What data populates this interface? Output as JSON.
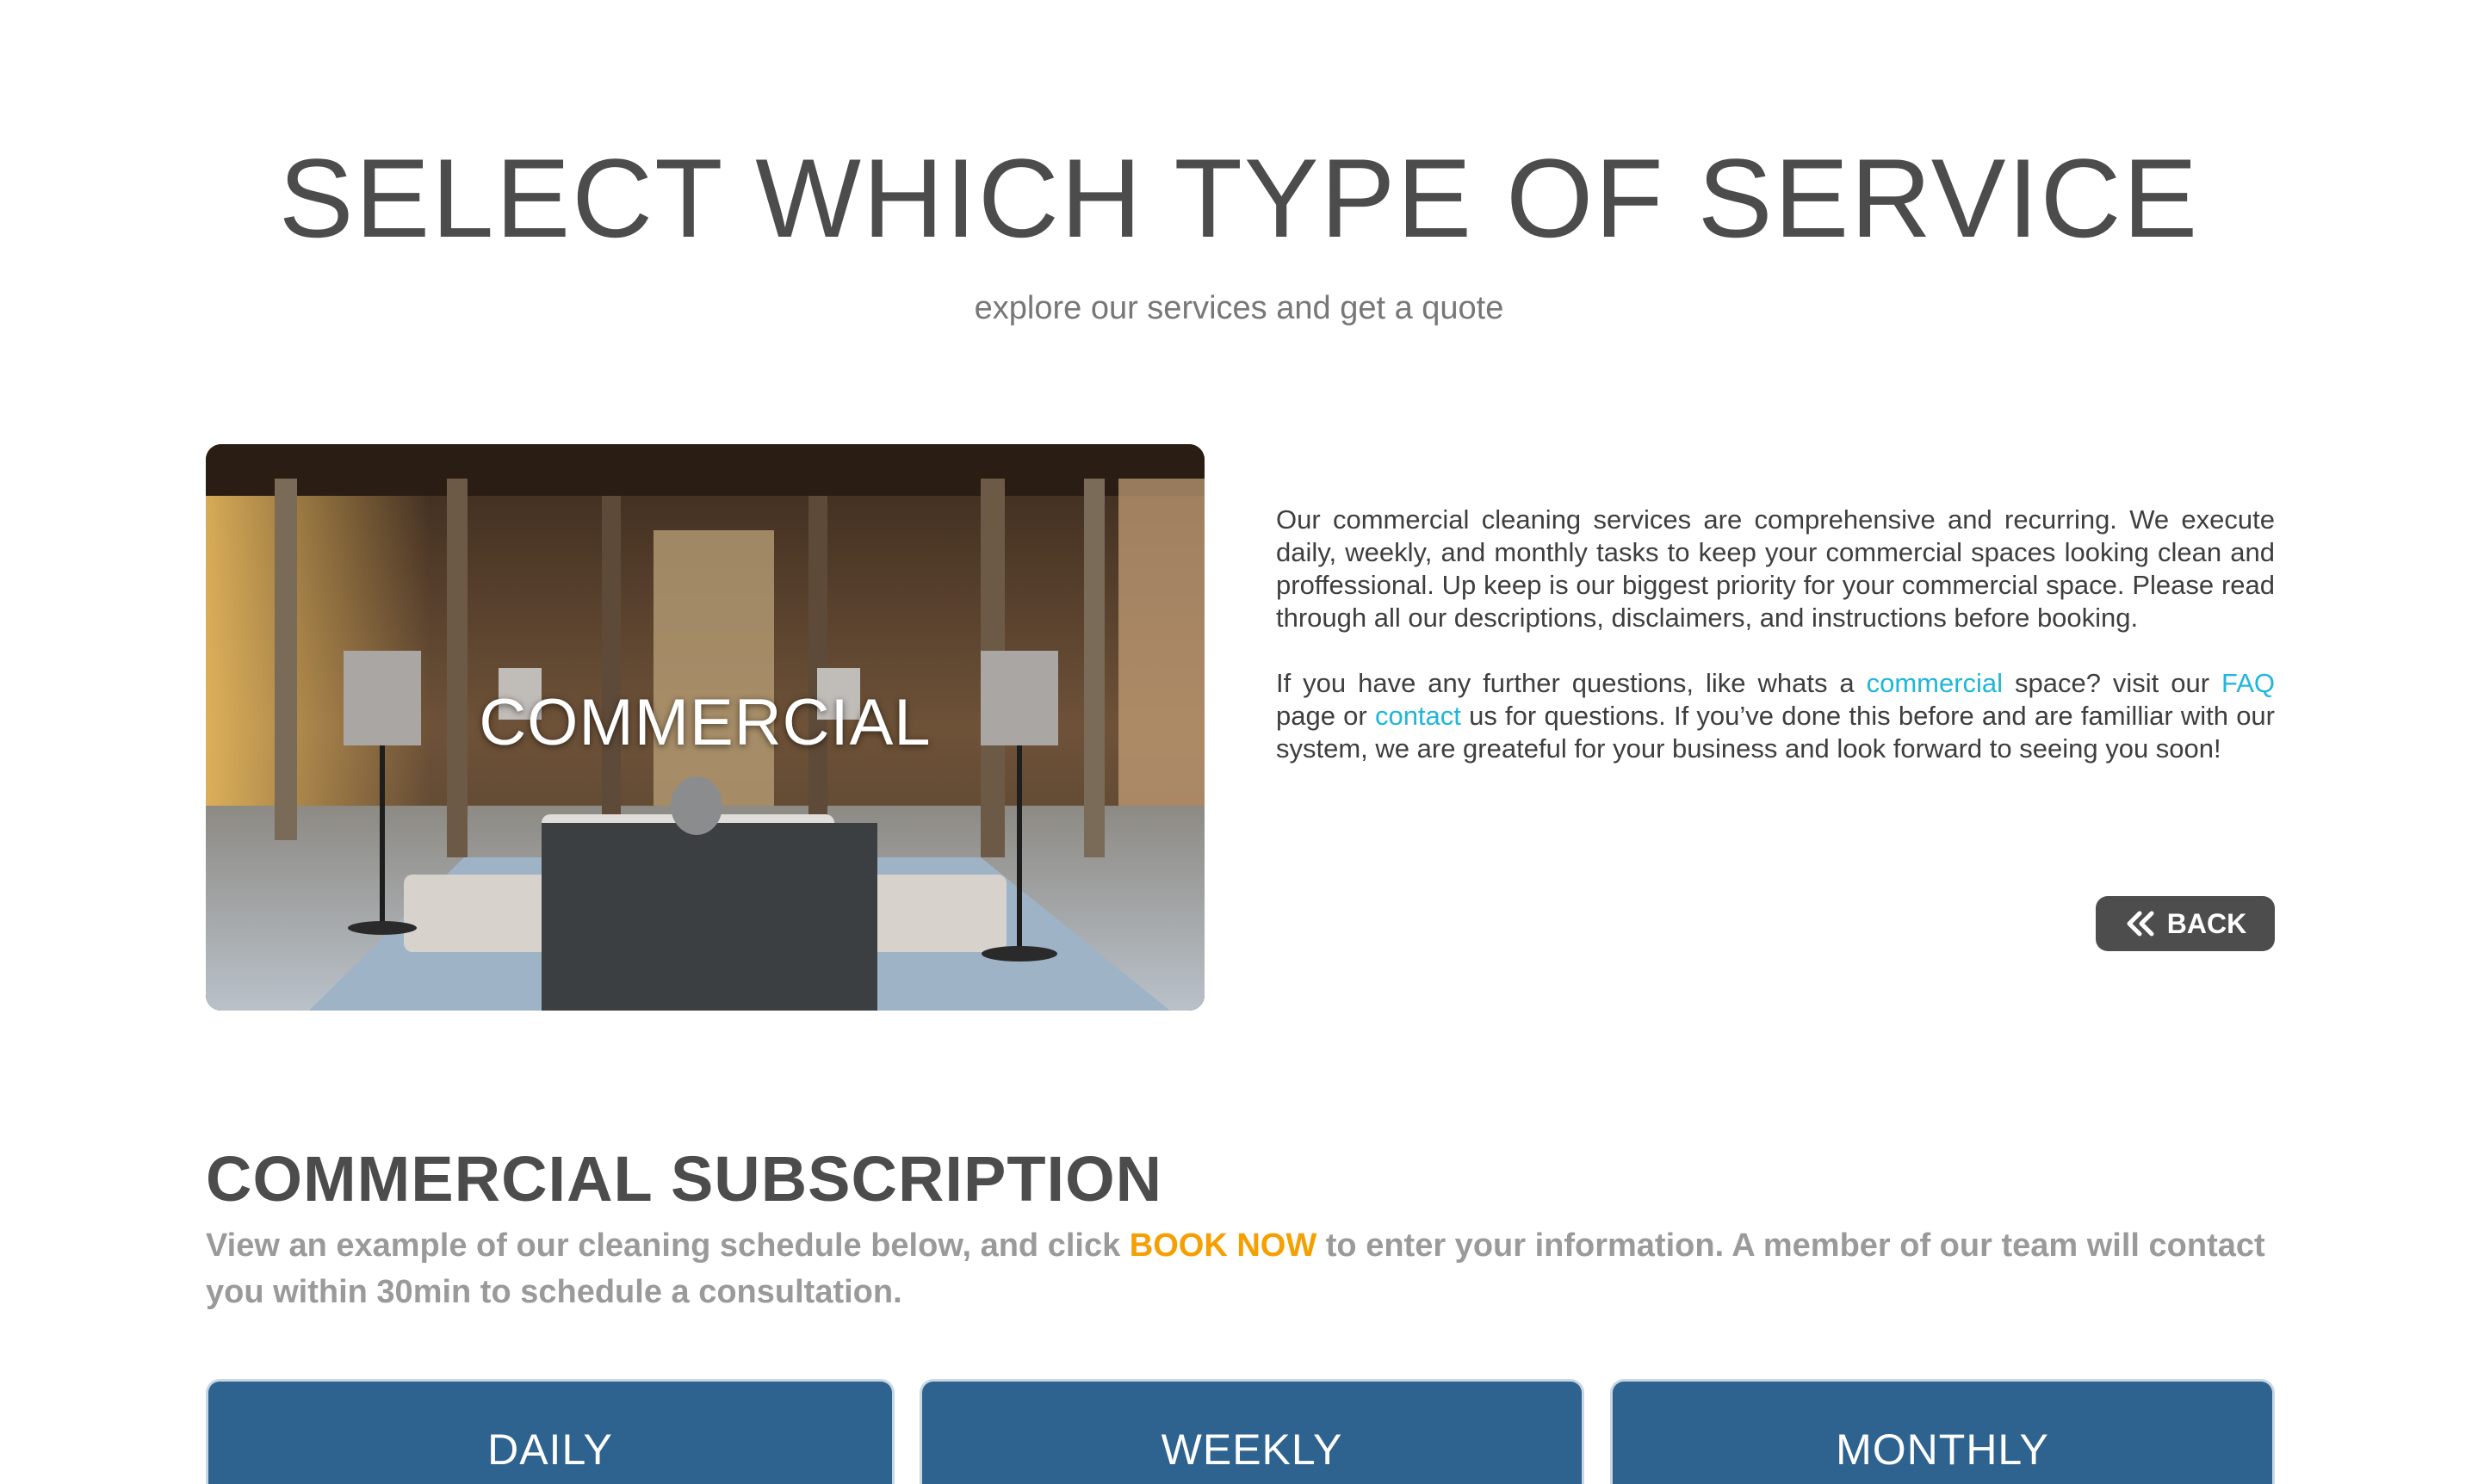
{
  "header": {
    "title": "SELECT WHICH TYPE OF SERVICE",
    "subtitle": "explore our services and get a quote"
  },
  "hero": {
    "label": "COMMERCIAL",
    "image_desc": "commercial-lobby-photo"
  },
  "description": {
    "p1": "Our commercial cleaning services are comprehensive and recurring. We execute daily, weekly, and monthly tasks to keep your commercial spaces looking clean and proffessional. Up keep is our biggest priority for your commercial space. Please read through all our descriptions, disclaimers, and instructions before booking.",
    "p2_a": "If you have any further questions, like whats a ",
    "p2_link1": "commercial",
    "p2_b": " space? visit our ",
    "p2_link2": "FAQ",
    "p2_c": " page or ",
    "p2_link3": "contact",
    "p2_d": " us for questions. If you’ve done this before and are familliar with our system, we are greateful for your business and look forward to seeing you soon!"
  },
  "back_button": {
    "label": "BACK",
    "icon": "double-chevron-left-icon"
  },
  "subscription": {
    "title": "COMMERCIAL SUBSCRIPTION",
    "text_a": "View an example of our cleaning schedule below, and click ",
    "book_now": "BOOK NOW",
    "text_b": " to enter your information. A member of our team will contact you within 30min to schedule a consultation."
  },
  "plans": [
    {
      "label": "DAILY"
    },
    {
      "label": "WEEKLY"
    },
    {
      "label": "MONTHLY"
    }
  ],
  "colors": {
    "link": "#1fb6d9",
    "accent_orange": "#f5a000",
    "plan_blue": "#2e628f",
    "button_gray": "#4d4d4d"
  }
}
